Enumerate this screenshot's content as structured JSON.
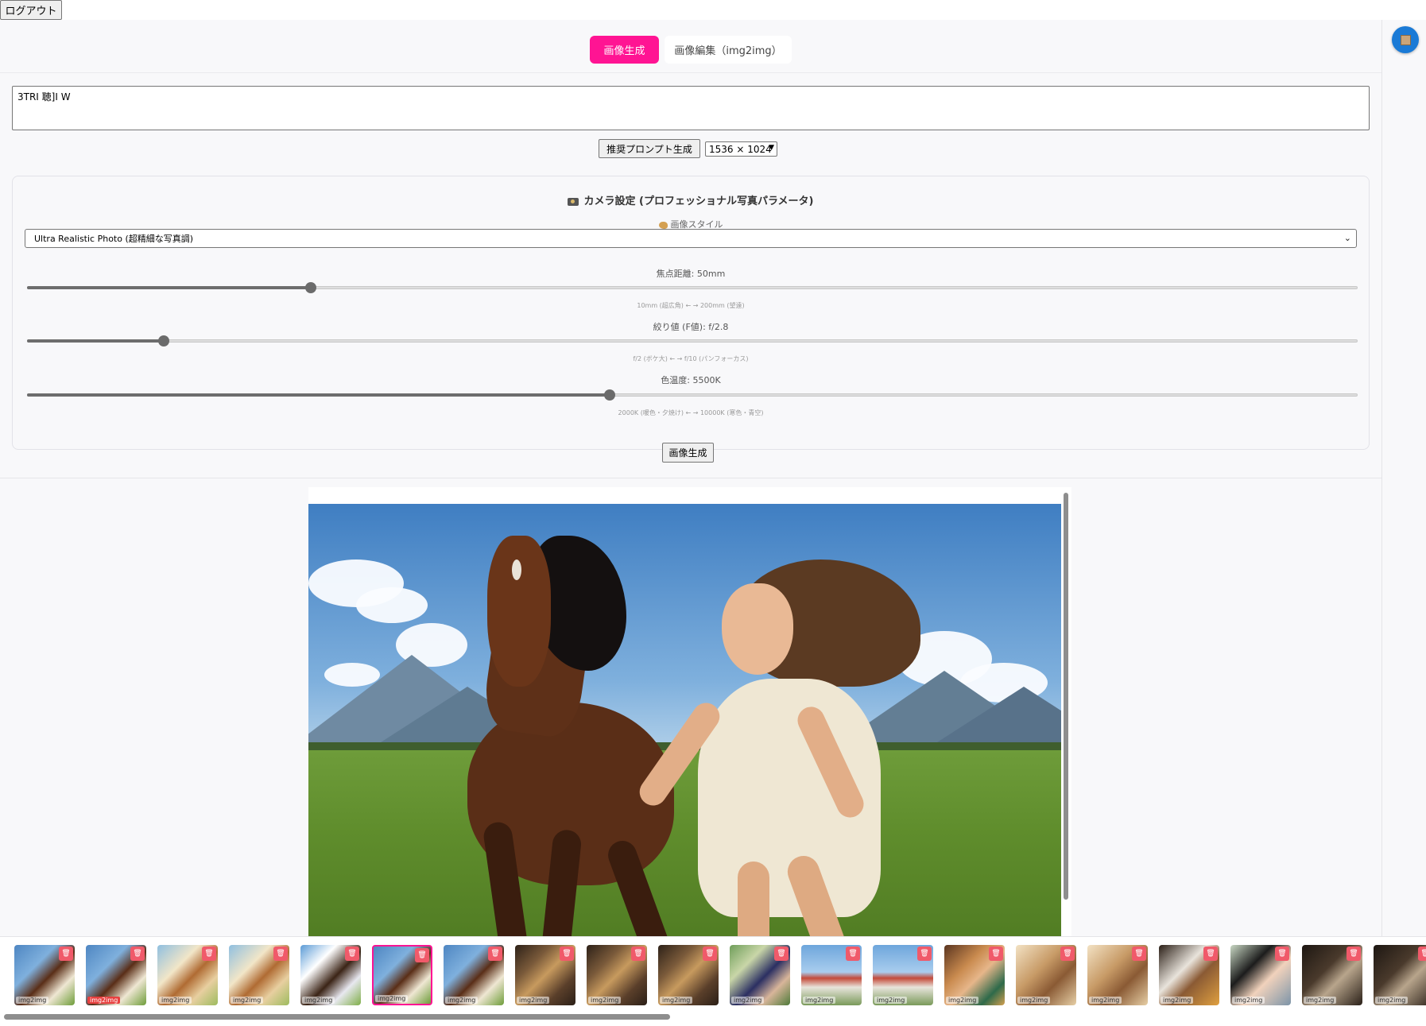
{
  "header": {
    "logout_label": "ログアウト"
  },
  "tabs": [
    {
      "label": "画像生成",
      "active": true
    },
    {
      "label": "画像編集（img2img）",
      "active": false
    }
  ],
  "prompt": {
    "value": "3TRI 聴]I W"
  },
  "controls": {
    "suggest_label": "推奨プロンプト生成",
    "size_value": "1536 × 1024"
  },
  "camera": {
    "title": "カメラ設定 (プロフェッショナル写真パラメータ)",
    "style_label": "画像スタイル",
    "style_value": "Ultra Realistic Photo (超精細な写真調)",
    "focal": {
      "label": "焦点距離: 50mm",
      "hint": "10mm (超広角) ← → 200mm (望遠)",
      "fraction": 0.213
    },
    "aperture": {
      "label": "絞り値 (F値): f/2.8",
      "hint": "f/2 (ボケ大) ← → f/10 (パンフォーカス)",
      "fraction": 0.103
    },
    "color_temp": {
      "label": "色温度: 5500K",
      "hint": "2000K (暖色・夕焼け) ← → 10000K (寒色・青空)",
      "fraction": 0.438
    }
  },
  "generate_label": "画像生成",
  "accent_color": "#ff1493",
  "thumbnails": [
    {
      "badge": "img2img",
      "theme": "horse-girl",
      "selected": false,
      "badge_red": false
    },
    {
      "badge": "img2img",
      "theme": "horse-girl",
      "selected": false,
      "badge_red": true
    },
    {
      "badge": "img2img",
      "theme": "horse-run-anime",
      "selected": false,
      "badge_red": false
    },
    {
      "badge": "img2img",
      "theme": "horse-run-anime",
      "selected": false,
      "badge_red": false
    },
    {
      "badge": "img2img",
      "theme": "horse-anime",
      "selected": false,
      "badge_red": false
    },
    {
      "badge": "img2img",
      "theme": "horse-girl",
      "selected": true,
      "badge_red": false
    },
    {
      "badge": "img2img",
      "theme": "horse-girl",
      "selected": false,
      "badge_red": false
    },
    {
      "badge": "img2img",
      "theme": "arcade",
      "selected": false,
      "badge_red": false
    },
    {
      "badge": "img2img",
      "theme": "arcade",
      "selected": false,
      "badge_red": false
    },
    {
      "badge": "img2img",
      "theme": "arcade",
      "selected": false,
      "badge_red": false
    },
    {
      "badge": "img2img",
      "theme": "park-girl",
      "selected": false,
      "badge_red": false
    },
    {
      "badge": "img2img",
      "theme": "tower",
      "selected": false,
      "badge_red": false
    },
    {
      "badge": "img2img",
      "theme": "tower",
      "selected": false,
      "badge_red": false
    },
    {
      "badge": "img2img",
      "theme": "anime-woman",
      "selected": false,
      "badge_red": false
    },
    {
      "badge": "img2img",
      "theme": "cat",
      "selected": false,
      "badge_red": false
    },
    {
      "badge": "img2img",
      "theme": "cat",
      "selected": false,
      "badge_red": false
    },
    {
      "badge": "img2img",
      "theme": "dog",
      "selected": false,
      "badge_red": false
    },
    {
      "badge": "img2img",
      "theme": "anime-girl",
      "selected": false,
      "badge_red": false
    },
    {
      "badge": "img2img",
      "theme": "dog-dark",
      "selected": false,
      "badge_red": false
    },
    {
      "badge": "img2img",
      "theme": "dog-dark",
      "selected": false,
      "badge_red": false
    }
  ]
}
